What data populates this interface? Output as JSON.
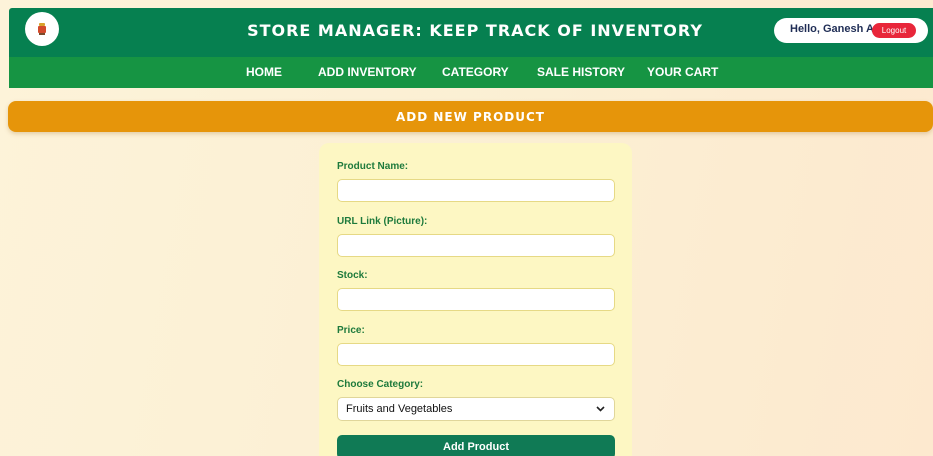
{
  "header": {
    "title": "STORE MANAGER: KEEP TRACK OF INVENTORY",
    "greeting": "Hello, Ganesh A",
    "logout_label": "Logout",
    "logo_icon": "store-logo-icon"
  },
  "nav": {
    "items": [
      {
        "label": "HOME"
      },
      {
        "label": "ADD INVENTORY"
      },
      {
        "label": "CATEGORY"
      },
      {
        "label": "SALE HISTORY"
      },
      {
        "label": "YOUR CART"
      }
    ]
  },
  "section": {
    "title": "ADD NEW PRODUCT"
  },
  "form": {
    "product_name_label": "Product Name:",
    "product_name_value": "",
    "url_label": "URL Link (Picture):",
    "url_value": "",
    "stock_label": "Stock:",
    "stock_value": "",
    "price_label": "Price:",
    "price_value": "",
    "category_label": "Choose Category:",
    "category_selected": "Fruits and Vegetables",
    "submit_label": "Add Product"
  },
  "colors": {
    "topbar": "#068050",
    "navbar": "#169443",
    "section_header": "#e6950a",
    "form_card": "#fdf7c3",
    "submit_button": "#107a55",
    "logout_button": "#e8263a"
  }
}
